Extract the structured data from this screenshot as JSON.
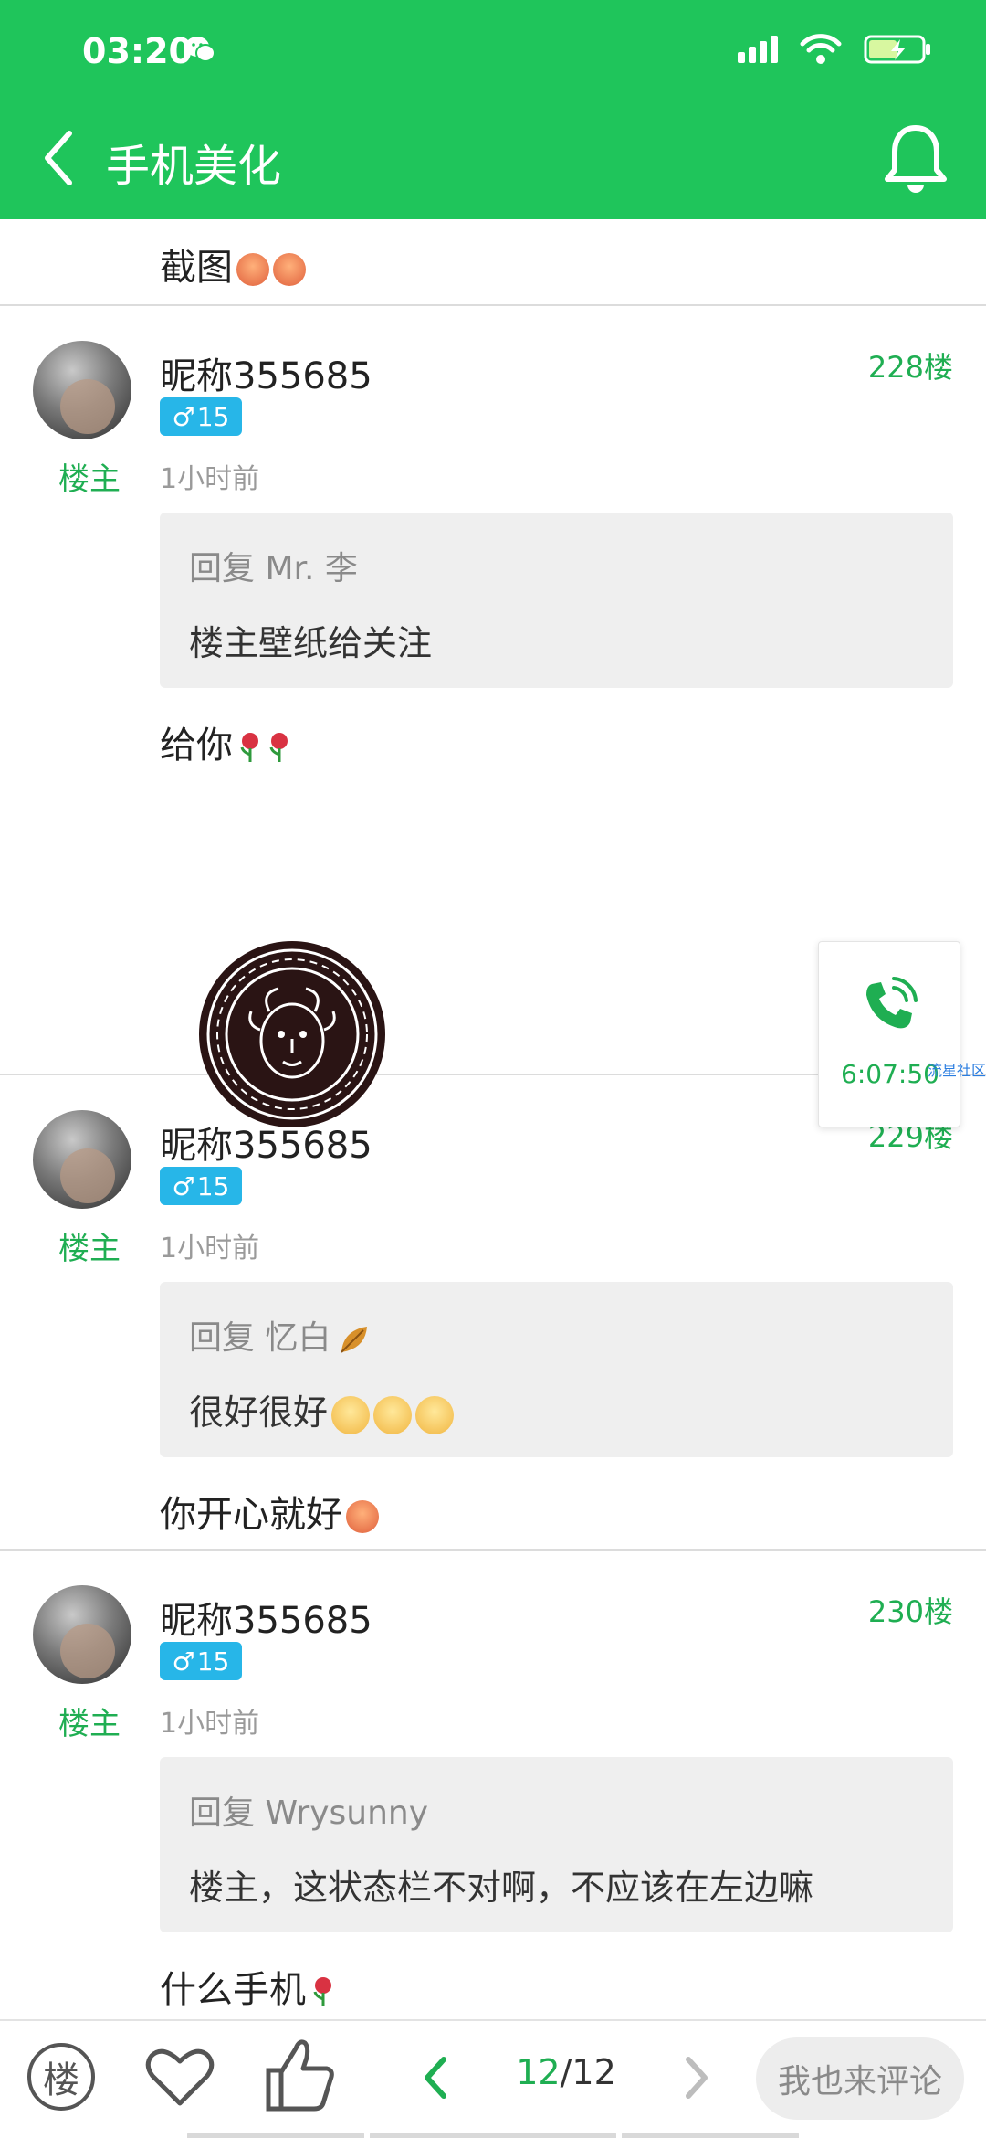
{
  "status_bar": {
    "time": "03:20"
  },
  "header": {
    "title": "手机美化"
  },
  "fragment": {
    "text": "截图"
  },
  "posts": [
    {
      "nickname": "昵称355685",
      "owner_tag": "楼主",
      "level": "15",
      "floor": "228楼",
      "time": "1小时前",
      "quote_head": "回复 Mr. 李",
      "quote_body": "楼主壁纸给关注",
      "reply": "给你"
    },
    {
      "nickname": "昵称355685",
      "owner_tag": "楼主",
      "level": "15",
      "floor": "229楼",
      "time": "1小时前",
      "quote_head": "回复 忆白",
      "quote_body": "很好很好",
      "reply": "你开心就好"
    },
    {
      "nickname": "昵称355685",
      "owner_tag": "楼主",
      "level": "15",
      "floor": "230楼",
      "time": "1小时前",
      "quote_head": "回复 Wrysunny",
      "quote_body": "楼主，这状态栏不对啊，不应该在左边嘛",
      "reply": "什么手机"
    }
  ],
  "call_widget": {
    "time": "6:07:50",
    "tag": "流星社区"
  },
  "bottom_bar": {
    "floor_label": "楼",
    "page_current": "12",
    "page_total": "/12",
    "comment_label": "我也来评论"
  },
  "colors": {
    "brand": "#1fc55b",
    "accent_text": "#1fae52",
    "badge": "#27b6e8"
  }
}
